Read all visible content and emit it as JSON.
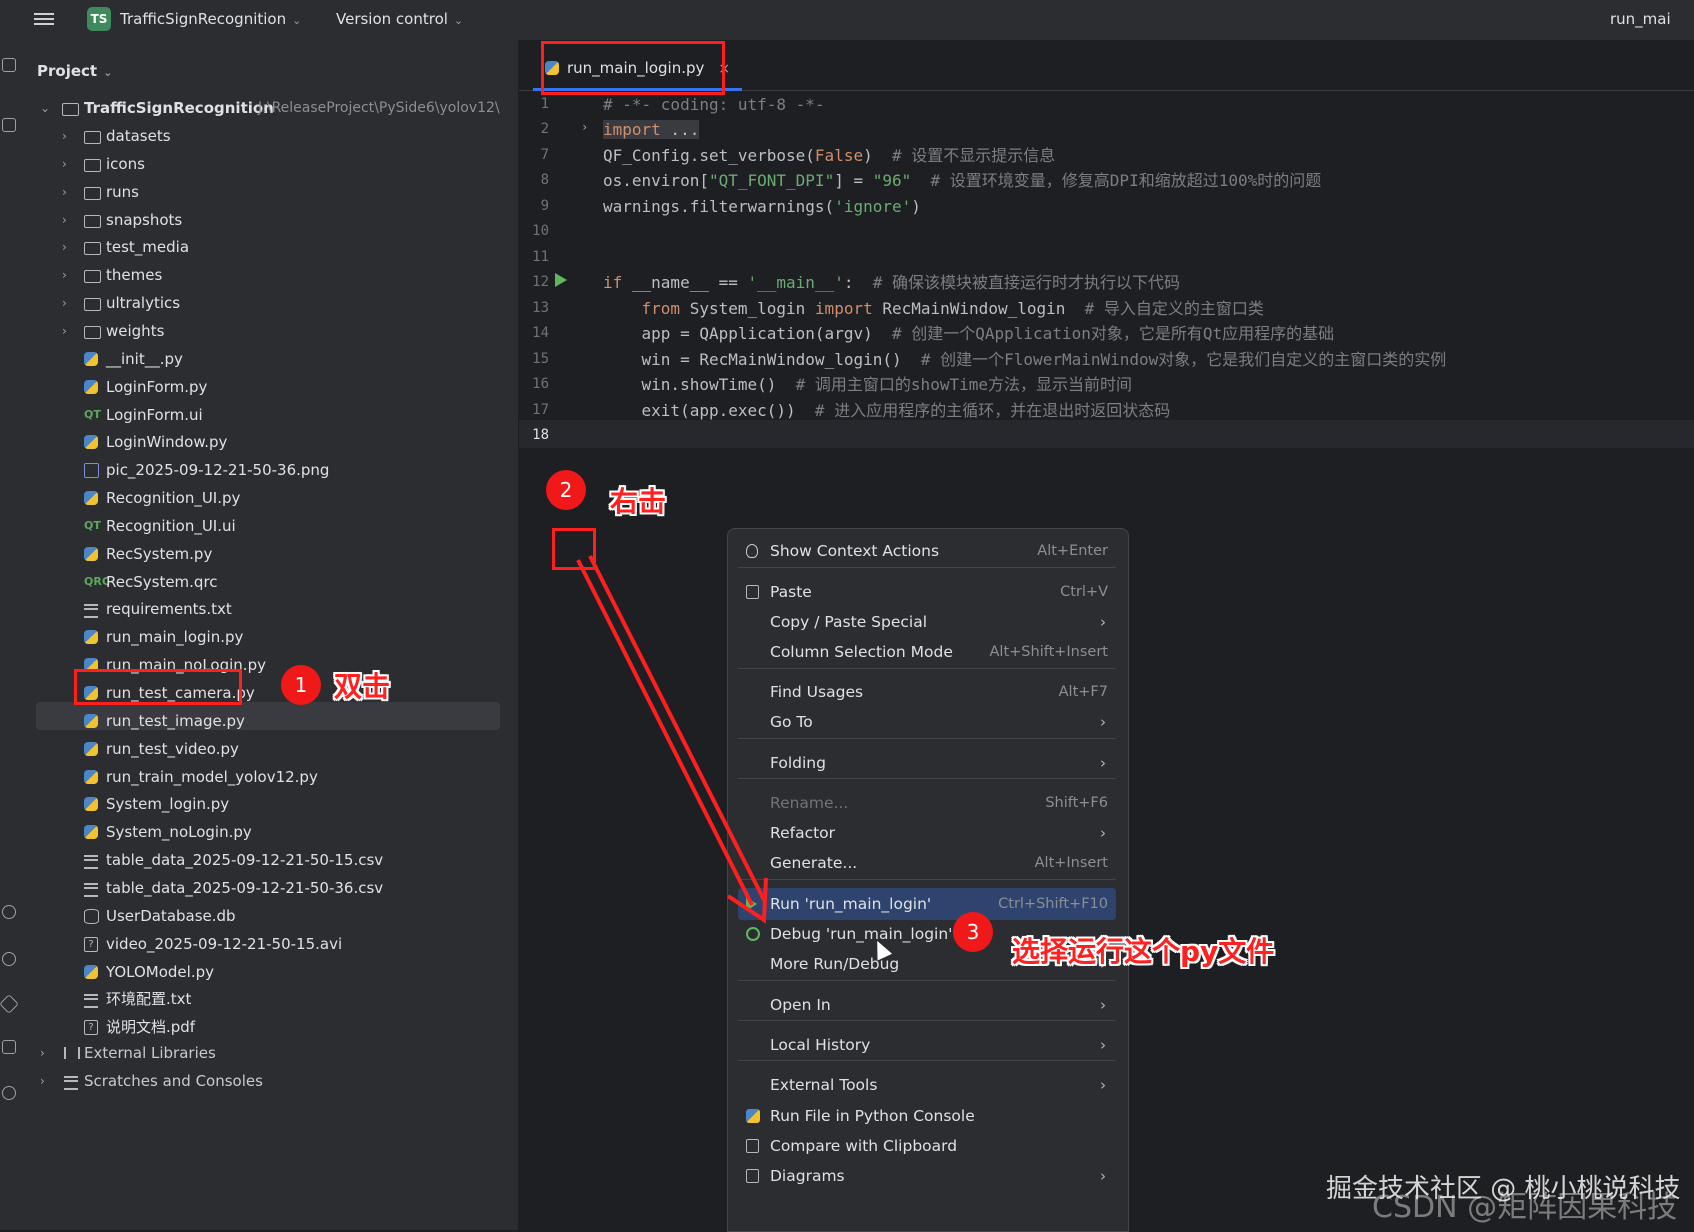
{
  "titlebar": {
    "project_badge": "TS",
    "project_name": "TrafficSignRecognition",
    "vcs_label": "Version control",
    "run_config": "run_mai"
  },
  "project_panel": {
    "title": "Project",
    "root": {
      "name": "TrafficSignRecognition",
      "path": "J:\\ReleaseProject\\PySide6\\yolov12\\"
    },
    "items": [
      {
        "name": "datasets",
        "type": "folder"
      },
      {
        "name": "icons",
        "type": "folder"
      },
      {
        "name": "runs",
        "type": "folder"
      },
      {
        "name": "snapshots",
        "type": "folder"
      },
      {
        "name": "test_media",
        "type": "folder"
      },
      {
        "name": "themes",
        "type": "folder"
      },
      {
        "name": "ultralytics",
        "type": "folder"
      },
      {
        "name": "weights",
        "type": "folder"
      },
      {
        "name": "__init__.py",
        "type": "py"
      },
      {
        "name": "LoginForm.py",
        "type": "py"
      },
      {
        "name": "LoginForm.ui",
        "type": "qt"
      },
      {
        "name": "LoginWindow.py",
        "type": "py"
      },
      {
        "name": "pic_2025-09-12-21-50-36.png",
        "type": "img"
      },
      {
        "name": "Recognition_UI.py",
        "type": "py"
      },
      {
        "name": "Recognition_UI.ui",
        "type": "qt"
      },
      {
        "name": "RecSystem.py",
        "type": "py"
      },
      {
        "name": "RecSystem.qrc",
        "type": "qrc"
      },
      {
        "name": "requirements.txt",
        "type": "txt"
      },
      {
        "name": "run_main_login.py",
        "type": "py"
      },
      {
        "name": "run_main_noLogin.py",
        "type": "py"
      },
      {
        "name": "run_test_camera.py",
        "type": "py"
      },
      {
        "name": "run_test_image.py",
        "type": "py"
      },
      {
        "name": "run_test_video.py",
        "type": "py"
      },
      {
        "name": "run_train_model_yolov12.py",
        "type": "py"
      },
      {
        "name": "System_login.py",
        "type": "py"
      },
      {
        "name": "System_noLogin.py",
        "type": "py"
      },
      {
        "name": "table_data_2025-09-12-21-50-15.csv",
        "type": "txt"
      },
      {
        "name": "table_data_2025-09-12-21-50-36.csv",
        "type": "txt"
      },
      {
        "name": "UserDatabase.db",
        "type": "db"
      },
      {
        "name": "video_2025-09-12-21-50-15.avi",
        "type": "unk"
      },
      {
        "name": "YOLOModel.py",
        "type": "py"
      },
      {
        "name": "环境配置.txt",
        "type": "txt"
      },
      {
        "name": "说明文档.pdf",
        "type": "unk"
      }
    ],
    "external_libraries": "External Libraries",
    "scratches": "Scratches and Consoles"
  },
  "editor": {
    "tab_name": "run_main_login.py",
    "tab_close": "×",
    "line_numbers": [
      "1",
      "2",
      "7",
      "8",
      "9",
      "10",
      "11",
      "12",
      "13",
      "14",
      "15",
      "16",
      "17",
      "18"
    ],
    "lines": {
      "l1": "# -*- coding: utf-8 -*-",
      "l2_kw": "import",
      "l2_rest": " ...",
      "l7_a": "QF_Config.set_verbose(",
      "l7_kw": "False",
      "l7_b": ")",
      "l7_cm": "  # 设置不显示提示信息",
      "l8_a": "os.environ[",
      "l8_s1": "\"QT_FONT_DPI\"",
      "l8_b": "] = ",
      "l8_s2": "\"96\"",
      "l8_cm": "  # 设置环境变量，修复高DPI和缩放超过100%时的问题",
      "l9_a": "warnings.filterwarnings(",
      "l9_s": "'ignore'",
      "l9_b": ")",
      "l12_kw": "if",
      "l12_a": " __name__ == ",
      "l12_s": "'__main__'",
      "l12_b": ":",
      "l12_cm": "  # 确保该模块被直接运行时才执行以下代码",
      "l13_kw1": "    from",
      "l13_a": " System_login ",
      "l13_kw2": "import",
      "l13_b": " RecMainWindow_login",
      "l13_cm": "  # 导入自定义的主窗口类",
      "l14_a": "    app = QApplication(argv)",
      "l14_cm": "  # 创建一个QApplication对象，它是所有Qt应用程序的基础",
      "l15_a": "    win = RecMainWindow_login()",
      "l15_cm": "  # 创建一个FlowerMainWindow对象，它是我们自定义的主窗口类的实例",
      "l16_a": "    win.showTime()",
      "l16_cm": "  # 调用主窗口的showTime方法，显示当前时间",
      "l17_a": "    exit(app.exec())",
      "l17_cm": "  # 进入应用程序的主循环，并在退出时返回状态码"
    }
  },
  "context_menu": {
    "items": [
      {
        "label": "Show Context Actions",
        "shortcut": "Alt+Enter"
      },
      {
        "label": "Paste",
        "shortcut": "Ctrl+V"
      },
      {
        "label": "Copy / Paste Special",
        "shortcut": ""
      },
      {
        "label": "Column Selection Mode",
        "shortcut": "Alt+Shift+Insert"
      },
      {
        "label": "Find Usages",
        "shortcut": "Alt+F7"
      },
      {
        "label": "Go To",
        "shortcut": ""
      },
      {
        "label": "Folding",
        "shortcut": ""
      },
      {
        "label": "Rename...",
        "shortcut": "Shift+F6"
      },
      {
        "label": "Refactor",
        "shortcut": ""
      },
      {
        "label": "Generate...",
        "shortcut": "Alt+Insert"
      },
      {
        "label": "Run 'run_main_login'",
        "shortcut": "Ctrl+Shift+F10"
      },
      {
        "label": "Debug 'run_main_login'",
        "shortcut": ""
      },
      {
        "label": "More Run/Debug",
        "shortcut": ""
      },
      {
        "label": "Open In",
        "shortcut": ""
      },
      {
        "label": "Local History",
        "shortcut": ""
      },
      {
        "label": "External Tools",
        "shortcut": ""
      },
      {
        "label": "Run File in Python Console",
        "shortcut": ""
      },
      {
        "label": "Compare with Clipboard",
        "shortcut": ""
      },
      {
        "label": "Diagrams",
        "shortcut": ""
      }
    ],
    "submenu_arrow": "›"
  },
  "annotations": {
    "badge1": "1",
    "badge2": "2",
    "badge3": "3",
    "text1": "双击",
    "text2": "右击",
    "text3": "选择运行这个py文件"
  },
  "watermark": {
    "text1": "掘金技术社区 @ 桃小桃说科技",
    "text2": "CSDN @矩阵因果科技"
  },
  "colors": {
    "annotation_red": "#ff1f1f",
    "highlight_blue": "#2e436e",
    "accent": "#3574f0"
  }
}
